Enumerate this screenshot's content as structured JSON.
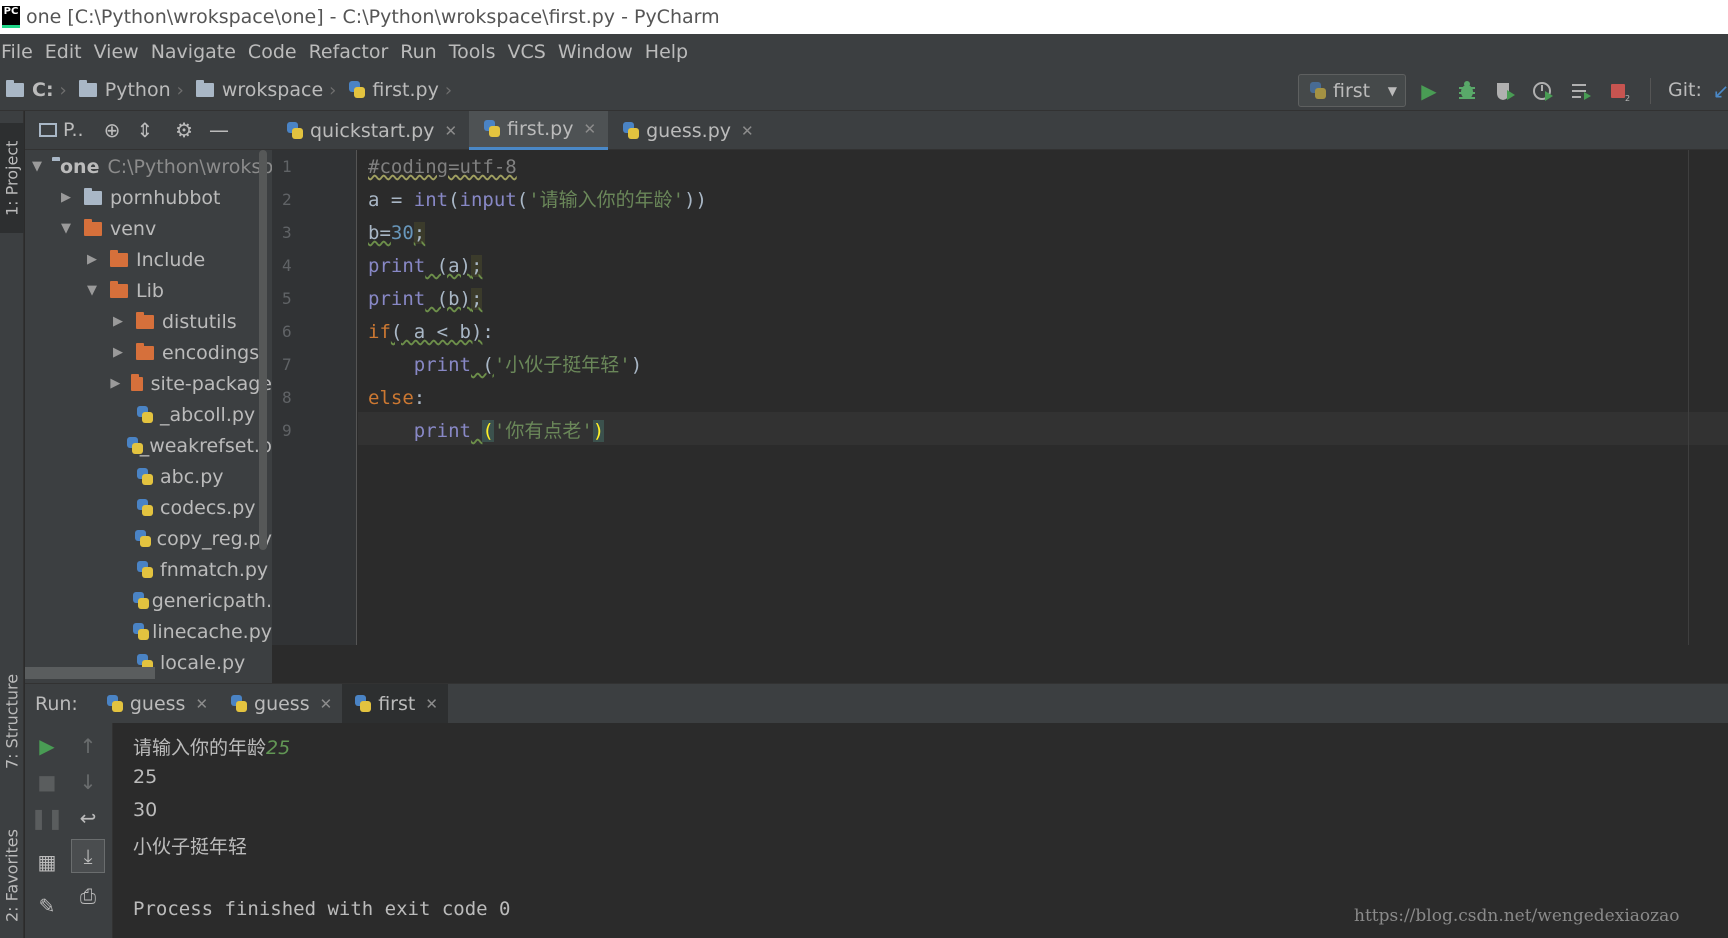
{
  "window": {
    "title": "one [C:\\Python\\wrokspace\\one] - C:\\Python\\wrokspace\\first.py - PyCharm",
    "app_logo": "PC"
  },
  "menu": [
    "File",
    "Edit",
    "View",
    "Navigate",
    "Code",
    "Refactor",
    "Run",
    "Tools",
    "VCS",
    "Window",
    "Help"
  ],
  "breadcrumbs": [
    "C:",
    "Python",
    "wrokspace",
    "first.py"
  ],
  "run_config": {
    "label": "first"
  },
  "toolbar": {
    "git_label": "Git:"
  },
  "tool_windows": {
    "project": "1: Project",
    "structure": "7: Structure",
    "favorites": "2: Favorites"
  },
  "project": {
    "view_label": "P..",
    "tree": [
      {
        "label": "one",
        "path": "C:\\Python\\wroksp",
        "type": "project",
        "arrow": "▼"
      },
      {
        "label": "pornhubbot",
        "type": "folder",
        "arrow": "▶"
      },
      {
        "label": "venv",
        "type": "folder-orange",
        "arrow": "▼"
      },
      {
        "label": "Include",
        "type": "folder-orange",
        "arrow": "▶"
      },
      {
        "label": "Lib",
        "type": "folder-orange",
        "arrow": "▼"
      },
      {
        "label": "distutils",
        "type": "folder-orange",
        "arrow": "▶"
      },
      {
        "label": "encodings",
        "type": "folder-orange",
        "arrow": "▶"
      },
      {
        "label": "site-package",
        "type": "folder-orange",
        "arrow": "▶"
      },
      {
        "label": "_abcoll.py",
        "type": "python-file",
        "arrow": ""
      },
      {
        "label": "_weakrefset.p",
        "type": "python-file",
        "arrow": ""
      },
      {
        "label": "abc.py",
        "type": "python-file",
        "arrow": ""
      },
      {
        "label": "codecs.py",
        "type": "python-file",
        "arrow": ""
      },
      {
        "label": "copy_reg.py",
        "type": "python-file",
        "arrow": ""
      },
      {
        "label": "fnmatch.py",
        "type": "python-file",
        "arrow": ""
      },
      {
        "label": "genericpath.",
        "type": "python-file",
        "arrow": ""
      },
      {
        "label": "linecache.py",
        "type": "python-file",
        "arrow": ""
      },
      {
        "label": "locale.py",
        "type": "python-file",
        "arrow": ""
      }
    ]
  },
  "editor": {
    "tabs": [
      {
        "label": "quickstart.py",
        "active": false
      },
      {
        "label": "first.py",
        "active": true
      },
      {
        "label": "guess.py",
        "active": false
      }
    ],
    "line_numbers": [
      "1",
      "2",
      "3",
      "4",
      "5",
      "6",
      "7",
      "8",
      "9"
    ],
    "code": {
      "l1": "#coding=utf-8",
      "l2_a": "a = ",
      "l2_int": "int",
      "l2_p1": "(",
      "l2_input": "input",
      "l2_p2": "(",
      "l2_str": "'请输入你的年龄'",
      "l2_end": "))",
      "l3_b": "b=",
      "l3_num": "30",
      "l3_semi": ";",
      "l4_print": "print",
      "l4_args": " (a)",
      "l4_semi": ";",
      "l5_print": "print",
      "l5_args": " (b)",
      "l5_semi": ";",
      "l6_if": "if",
      "l6_cond": "( a < b)",
      "l6_colon": ":",
      "l7_indent": "    ",
      "l7_print": "print",
      "l7_sp": " (",
      "l7_str": "'小伙子挺年轻'",
      "l7_end": ")",
      "l8_else": "else",
      "l8_colon": ":",
      "l9_indent": "    ",
      "l9_print": "print",
      "l9_sp": " ",
      "l9_open": "(",
      "l9_str": "'你有点老'",
      "l9_close": ")"
    }
  },
  "run": {
    "label": "Run:",
    "tabs": [
      {
        "label": "guess",
        "active": false
      },
      {
        "label": "guess",
        "active": false
      },
      {
        "label": "first",
        "active": true
      }
    ],
    "console": {
      "prompt": "请输入你的年龄",
      "input": "25",
      "line2": "25",
      "line3": "30",
      "line4": "小伙子挺年轻",
      "exit": "Process finished with exit code 0"
    }
  },
  "watermark": "https://blog.csdn.net/wengedexiaozao",
  "colors": {
    "run_green": "#499c54",
    "debug_green": "#59a869",
    "stop_red": "#c75450",
    "accent_blue": "#4a88c7"
  }
}
